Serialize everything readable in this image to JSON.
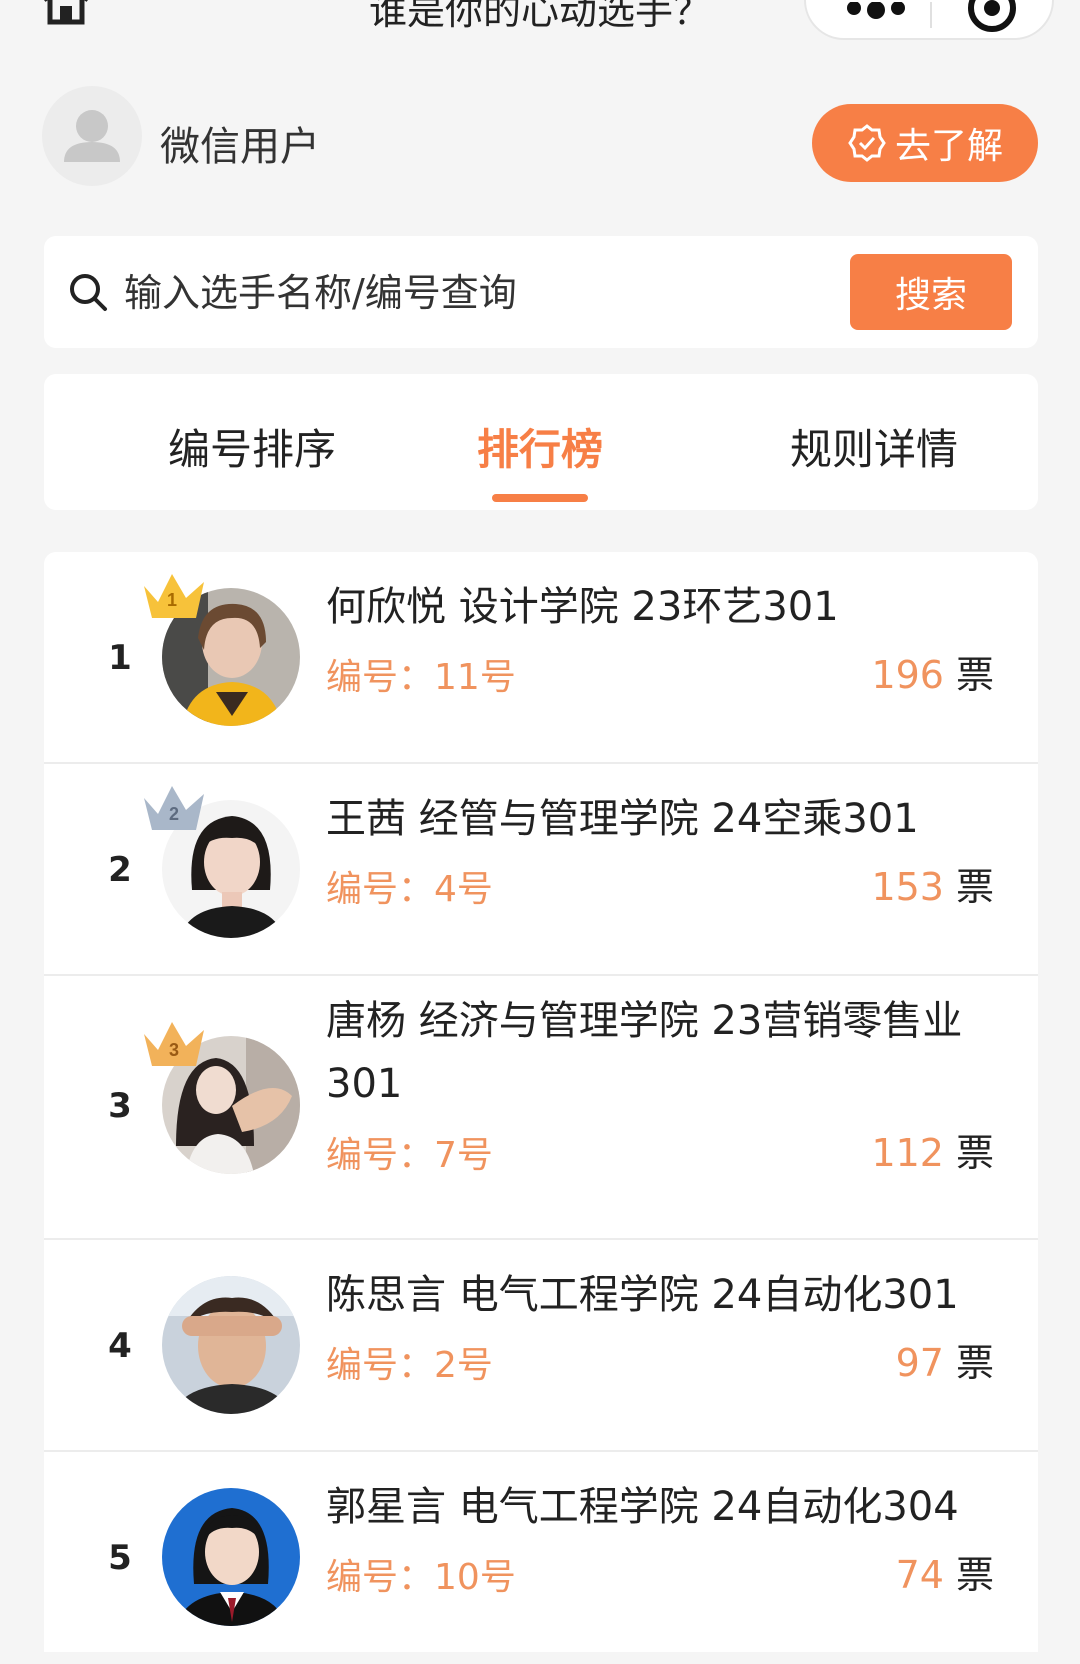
{
  "header": {
    "title": "谁是你的心动选手？"
  },
  "user": {
    "name": "微信用户",
    "learn_label": "去了解"
  },
  "search": {
    "placeholder": "输入选手名称/编号查询",
    "button_label": "搜索"
  },
  "tabs": [
    {
      "label": "编号排序",
      "active": false
    },
    {
      "label": "排行榜",
      "active": true
    },
    {
      "label": "规则详情",
      "active": false
    }
  ],
  "id_prefix": "编号：",
  "votes_unit": "票",
  "contestants": [
    {
      "rank": "1",
      "name": "何欣悦 设计学院 23环艺301",
      "id": "11号",
      "votes": "196",
      "crown": "1"
    },
    {
      "rank": "2",
      "name": "王茜 经管与管理学院 24空乘301",
      "id": "4号",
      "votes": "153",
      "crown": "2"
    },
    {
      "rank": "3",
      "name": "唐杨 经济与管理学院 23营销零售业301",
      "id": "7号",
      "votes": "112",
      "crown": "3"
    },
    {
      "rank": "4",
      "name": "陈思言 电气工程学院 24自动化301",
      "id": "2号",
      "votes": "97",
      "crown": ""
    },
    {
      "rank": "5",
      "name": "郭星言 电气工程学院 24自动化304",
      "id": "10号",
      "votes": "74",
      "crown": ""
    }
  ],
  "colors": {
    "accent": "#f77f46",
    "accent_text": "#f0935e",
    "gold": "#f7c23a",
    "silver": "#a9b7c9",
    "bronze": "#f2b25a"
  }
}
